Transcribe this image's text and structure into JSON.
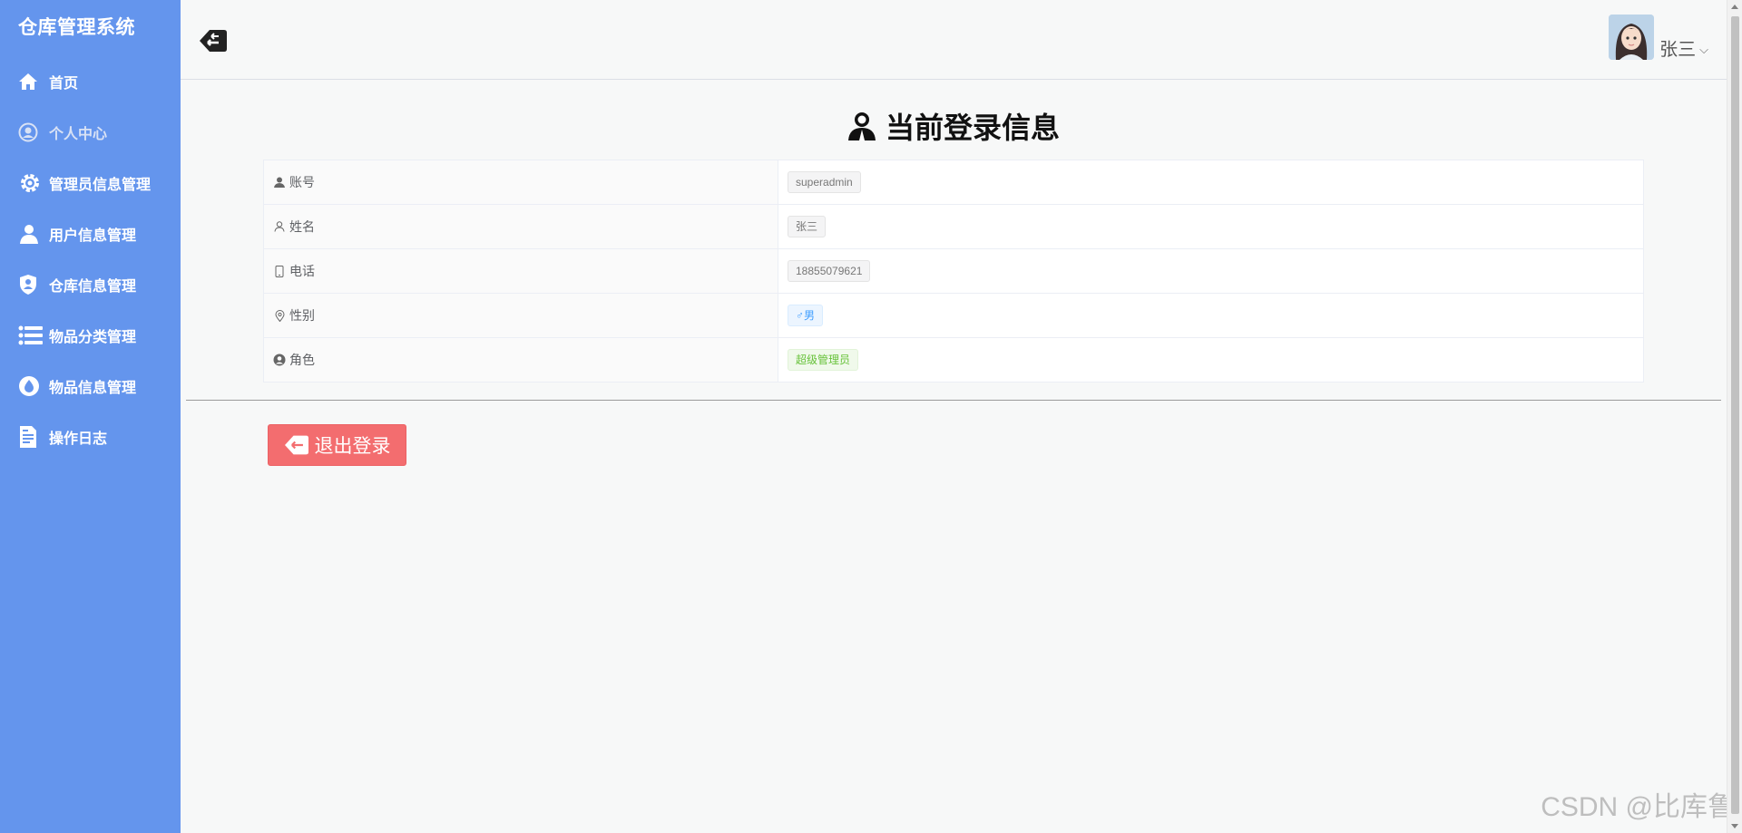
{
  "sidebar": {
    "brand": "仓库管理系统",
    "items": [
      {
        "label": "首页",
        "icon": "home-icon"
      },
      {
        "label": "个人中心",
        "icon": "user-circle-icon"
      },
      {
        "label": "管理员信息管理",
        "icon": "gear-icon"
      },
      {
        "label": "用户信息管理",
        "icon": "user-icon"
      },
      {
        "label": "仓库信息管理",
        "icon": "shield-user-icon"
      },
      {
        "label": "物品分类管理",
        "icon": "list-icon"
      },
      {
        "label": "物品信息管理",
        "icon": "drop-icon"
      },
      {
        "label": "操作日志",
        "icon": "document-icon"
      }
    ],
    "active_index": 1
  },
  "header": {
    "user_name": "张三",
    "caret": "⌵"
  },
  "main": {
    "title": "当前登录信息",
    "rows": [
      {
        "label": "账号",
        "value": "superadmin",
        "tag": "default"
      },
      {
        "label": "姓名",
        "value": "张三",
        "tag": "default"
      },
      {
        "label": "电话",
        "value": "18855079621",
        "tag": "default"
      },
      {
        "label": "性别",
        "value": "♂男",
        "tag": "blue"
      },
      {
        "label": "角色",
        "value": "超级管理员",
        "tag": "green"
      }
    ],
    "logout_label": "退出登录"
  },
  "watermark": "CSDN @比库鲁",
  "colors": {
    "sidebar": "#6495ed",
    "logout": "#f36d6f",
    "tag_blue": "#409eff",
    "tag_green": "#67c23a"
  }
}
